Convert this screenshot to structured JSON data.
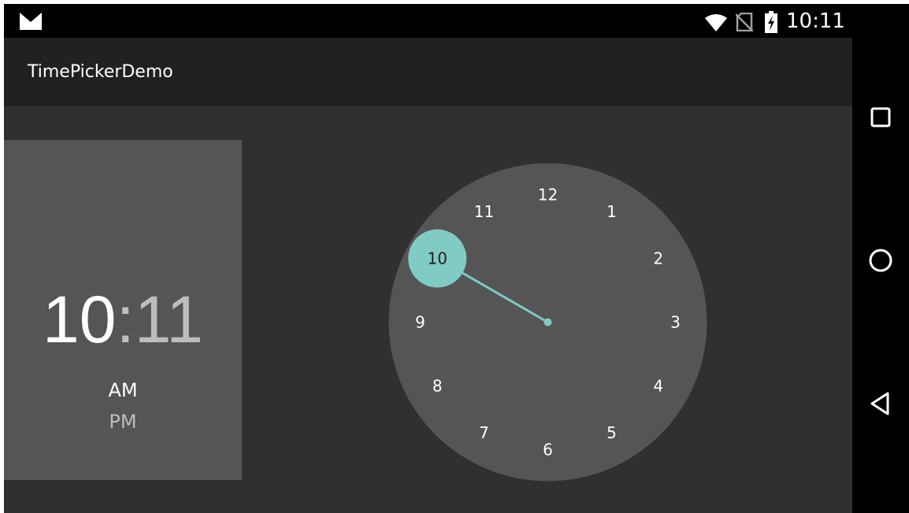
{
  "status_bar": {
    "time": "10:11",
    "icons": [
      "app-logo-icon",
      "wifi-icon",
      "no-sim-icon",
      "battery-charging-icon"
    ]
  },
  "app_bar": {
    "title": "TimePickerDemo"
  },
  "time_picker": {
    "hour": "10",
    "separator": ":",
    "minute": "11",
    "am_label": "AM",
    "pm_label": "PM",
    "selected_period": "AM",
    "selected_hour": 10,
    "clock_numbers": [
      "12",
      "1",
      "2",
      "3",
      "4",
      "5",
      "6",
      "7",
      "8",
      "9",
      "10",
      "11"
    ]
  },
  "nav_bar": {
    "buttons": [
      "recents-icon",
      "home-icon",
      "back-icon"
    ]
  },
  "colors": {
    "accent": "#80cbc4",
    "panel": "#555555",
    "background": "#303030",
    "app_bar": "#212121"
  }
}
